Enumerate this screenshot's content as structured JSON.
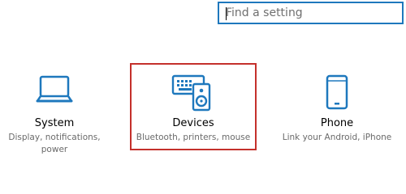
{
  "search": {
    "placeholder": "Find a setting",
    "value": ""
  },
  "tiles": [
    {
      "title": "System",
      "subtitle": "Display, notifications, power",
      "icon": "laptop-icon"
    },
    {
      "title": "Devices",
      "subtitle": "Bluetooth, printers, mouse",
      "icon": "keyboard-speaker-icon"
    },
    {
      "title": "Phone",
      "subtitle": "Link your Android, iPhone",
      "icon": "phone-icon"
    }
  ],
  "colors": {
    "accent": "#1e78bd",
    "selection_border": "#c4302b",
    "subtitle_text": "#6a6a6a"
  }
}
